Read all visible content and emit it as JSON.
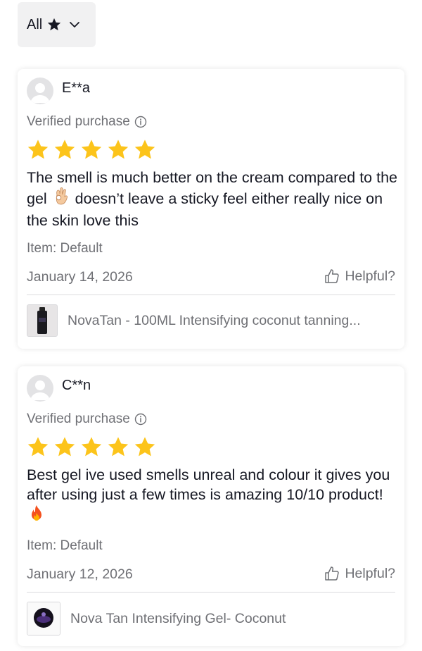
{
  "filter": {
    "label": "All",
    "star_icon": "star-icon",
    "chevron_icon": "chevron-down-icon"
  },
  "reviews": [
    {
      "user": "E**a",
      "verified_label": "Verified purchase",
      "rating": 5,
      "text_parts": [
        "The smell is much better on the cream compared to the gel",
        "doesn’t leave a sticky feel either really nice on the skin love this"
      ],
      "emoji": "ok-hand-emoji",
      "item": "Item: Default",
      "date": "January 14, 2026",
      "helpful_label": "Helpful?",
      "product_name": "NovaTan - 100ML Intensifying coconut tanning..."
    },
    {
      "user": "C**n",
      "verified_label": "Verified purchase",
      "rating": 5,
      "text_parts": [
        "Best gel ive used smells unreal and colour it gives you after using just a few times is amazing 10/10 product!",
        ""
      ],
      "emoji": "fire-emoji",
      "item": "Item: Default",
      "date": "January 12, 2026",
      "helpful_label": "Helpful?",
      "product_name": "Nova Tan Intensifying Gel- Coconut"
    }
  ],
  "colors": {
    "star": "#fcc41b",
    "text_primary": "#161823",
    "text_secondary": "#6f7075"
  }
}
